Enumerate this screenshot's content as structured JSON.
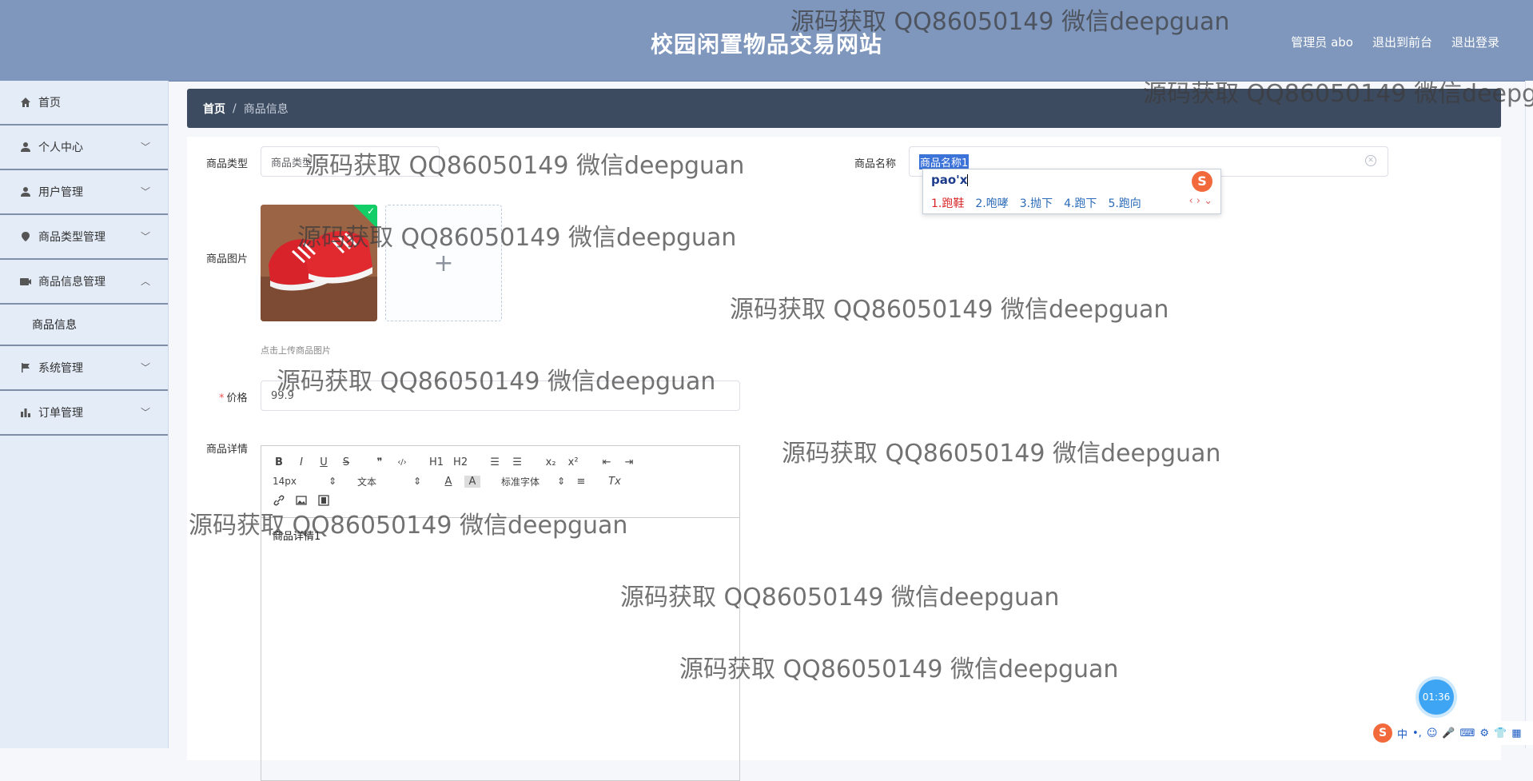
{
  "header": {
    "site_title": "校园闲置物品交易网站",
    "admin_label": "管理员 abo",
    "to_front_label": "退出到前台",
    "logout_label": "退出登录"
  },
  "sidebar": {
    "items": [
      {
        "label": "首页",
        "icon": "home-icon"
      },
      {
        "label": "个人中心",
        "icon": "user-icon"
      },
      {
        "label": "用户管理",
        "icon": "user-icon"
      },
      {
        "label": "商品类型管理",
        "icon": "location-icon"
      },
      {
        "label": "商品信息管理",
        "icon": "camera-icon"
      },
      {
        "label": "商品信息",
        "icon": ""
      },
      {
        "label": "系统管理",
        "icon": "flag-icon"
      },
      {
        "label": "订单管理",
        "icon": "bar-chart-icon"
      }
    ]
  },
  "breadcrumb": {
    "home": "首页",
    "separator": "/",
    "current": "商品信息"
  },
  "form": {
    "type_label": "商品类型",
    "type_value": "商品类型",
    "name_label": "商品名称",
    "name_value": "商品名称1",
    "image_label": "商品图片",
    "upload_plus": "+",
    "upload_hint": "点击上传商品图片",
    "price_required": "*",
    "price_label": "价格",
    "price_value": "99.9",
    "detail_label": "商品详情",
    "detail_content": "商品详情1"
  },
  "editor_toolbar": {
    "bold": "B",
    "italic": "I",
    "underline": "U",
    "strike": "S",
    "quote": "❞",
    "code": "‹/›",
    "h1": "H1",
    "h2": "H2",
    "ordered_list": "☰",
    "bullet_list": "☰",
    "subscript": "x₂",
    "superscript": "x²",
    "outdent": "⇤",
    "indent": "⇥",
    "size": "14px",
    "format": "文本",
    "font": "标准字体",
    "color": "A",
    "background": "A",
    "align": "≡",
    "clean": "Tx"
  },
  "ime_popup": {
    "input": "pao'x",
    "logo": "S",
    "candidates": [
      "1.跑鞋",
      "2.咆哮",
      "3.抛下",
      "4.跑下",
      "5.跑向"
    ],
    "nav": "‹ › ⌄"
  },
  "timer": "01:36",
  "ime_bar": {
    "logo": "S",
    "mode": "中",
    "punct": "•,",
    "icons": [
      "☺",
      "🎤",
      "⌨",
      "⚙",
      "👕",
      "▦"
    ]
  },
  "watermark_text": "源码获取 QQ86050149 微信deepguan"
}
